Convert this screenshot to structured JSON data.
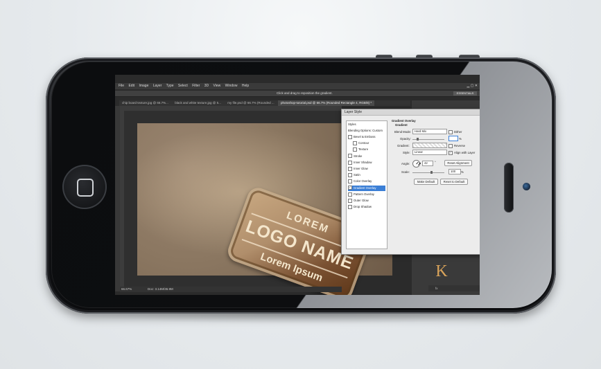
{
  "photoshop": {
    "menu": [
      "File",
      "Edit",
      "Image",
      "Layer",
      "Type",
      "Select",
      "Filter",
      "3D",
      "View",
      "Window",
      "Help"
    ],
    "options_hint": "Click and drag to reposition the gradient.",
    "workspace": "ESSENTIALS",
    "tabs": [
      "chip board texture.jpg @ 66.7%...",
      "black and white texture.jpg @ 5...",
      "my file.psd @ 66.7% (Rounded ...",
      "photoshop-tutorial.psd @ 66.7% (Rounded Rectangle 4, RGB/8) *"
    ],
    "zoom": "66.67%",
    "doc_size": "Doc: 3.14M/36.9M",
    "logo": {
      "line1": "LOREM",
      "line2": "LOGO NAME",
      "line3": "Lorem Ipsum"
    },
    "panel_letter": "K",
    "panel_footer": "fx",
    "dialog": {
      "title": "Layer Style",
      "styles_header": "Styles",
      "blending": "Blending Options: Custom",
      "items": [
        {
          "label": "Bevel & Emboss",
          "checked": false,
          "indent": false
        },
        {
          "label": "Contour",
          "checked": false,
          "indent": true
        },
        {
          "label": "Texture",
          "checked": false,
          "indent": true
        },
        {
          "label": "Stroke",
          "checked": false,
          "indent": false
        },
        {
          "label": "Inner Shadow",
          "checked": false,
          "indent": false
        },
        {
          "label": "Inner Glow",
          "checked": false,
          "indent": false
        },
        {
          "label": "Satin",
          "checked": false,
          "indent": false
        },
        {
          "label": "Color Overlay",
          "checked": false,
          "indent": false
        },
        {
          "label": "Gradient Overlay",
          "checked": true,
          "indent": false,
          "selected": true
        },
        {
          "label": "Pattern Overlay",
          "checked": false,
          "indent": false
        },
        {
          "label": "Outer Glow",
          "checked": false,
          "indent": false
        },
        {
          "label": "Drop Shadow",
          "checked": false,
          "indent": false
        }
      ],
      "section_title": "Gradient Overlay",
      "section_sub": "Gradient",
      "blend_mode_label": "Blend Mode:",
      "blend_mode": "Hard Mix",
      "dither": "Dither",
      "opacity_label": "Opacity:",
      "opacity_unit": "%",
      "gradient_label": "Gradient:",
      "reverse": "Reverse",
      "style_label": "Style:",
      "style_value": "Linear",
      "align": "Align with Layer",
      "angle_label": "Angle:",
      "angle_value": "42",
      "angle_unit": "°",
      "reset_alignment": "Reset Alignment",
      "scale_label": "Scale:",
      "scale_value": "100",
      "scale_unit": "%",
      "make_default": "Make Default",
      "reset_default": "Reset to Default"
    }
  }
}
